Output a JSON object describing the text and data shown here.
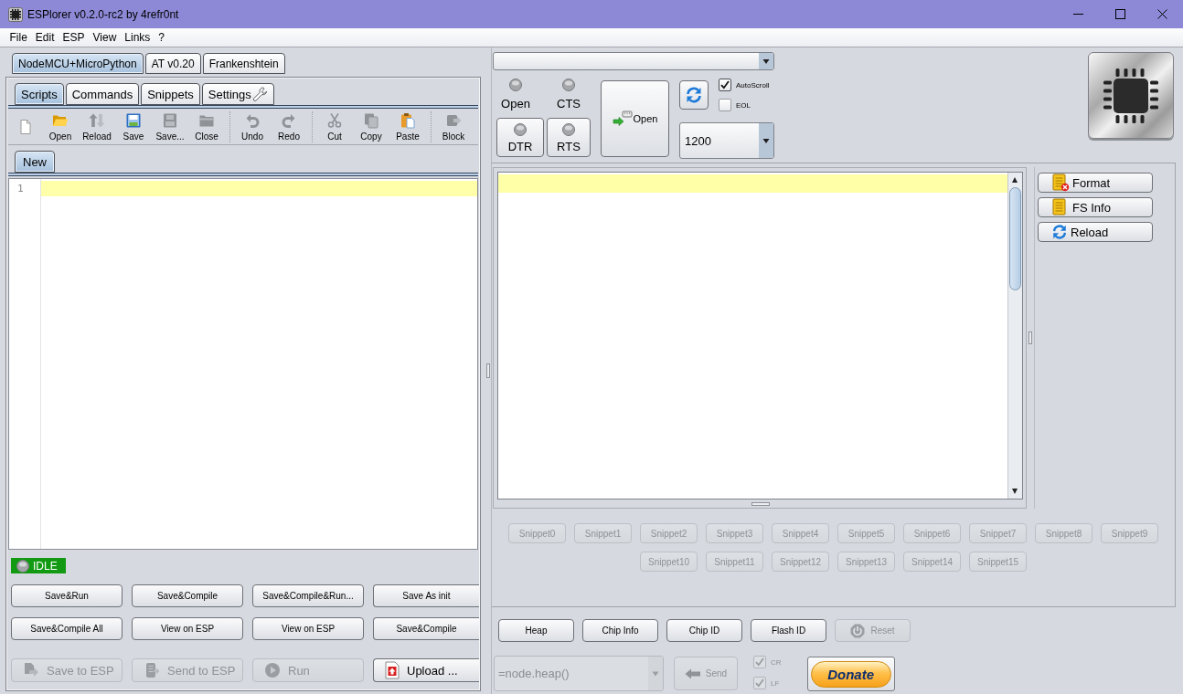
{
  "window": {
    "title": "ESPlorer v0.2.0-rc2 by 4refr0nt"
  },
  "menu": [
    "File",
    "Edit",
    "ESP",
    "View",
    "Links",
    "?"
  ],
  "firmware_tabs": [
    {
      "label": "NodeMCU+MicroPython",
      "selected": true
    },
    {
      "label": "AT v0.20",
      "selected": false
    },
    {
      "label": "Frankenshtein",
      "selected": false
    }
  ],
  "scripts_panel": {
    "tabs": [
      {
        "label": "Scripts",
        "selected": true,
        "kind": "plain"
      },
      {
        "label": "Commands",
        "selected": false,
        "kind": "plain"
      },
      {
        "label": "Snippets",
        "selected": false,
        "kind": "plain"
      },
      {
        "label": "Settings",
        "selected": false,
        "kind": "settings"
      }
    ],
    "toolbar_groups": [
      {
        "items": [
          {
            "kind": "new",
            "disabled": false
          },
          {
            "label": "Open",
            "kind": "open",
            "disabled": false
          },
          {
            "label": "Reload",
            "kind": "reload",
            "disabled": true
          },
          {
            "label": "Save",
            "kind": "save",
            "disabled": false
          },
          {
            "label": "Save...",
            "kind": "save-as",
            "disabled": true
          },
          {
            "label": "Close",
            "kind": "close",
            "disabled": true
          }
        ]
      },
      {
        "items": [
          {
            "label": "Undo",
            "kind": "undo",
            "disabled": true
          },
          {
            "label": "Redo",
            "kind": "redo",
            "disabled": true
          }
        ]
      },
      {
        "items": [
          {
            "label": "Cut",
            "kind": "cut",
            "disabled": true
          },
          {
            "label": "Copy",
            "kind": "copy",
            "disabled": true
          },
          {
            "label": "Paste",
            "kind": "paste",
            "disabled": false
          }
        ]
      },
      {
        "items": [
          {
            "label": "Block",
            "kind": "block",
            "disabled": true
          }
        ]
      }
    ],
    "file_tabs": [
      {
        "label": "New",
        "selected": true
      }
    ],
    "editor": {
      "line_numbers": [
        "1"
      ]
    },
    "status": {
      "label": "IDLE"
    },
    "actions": [
      "Save&Run",
      "Save&Compile",
      "Save&Compile&Run...",
      "Save As init",
      "Save&Compile All",
      "View on ESP",
      "View on ESP",
      "Save&Compile"
    ],
    "transfer_buttons": [
      {
        "label": "Save to ESP",
        "kind": "save",
        "disabled": true
      },
      {
        "label": "Send to ESP",
        "kind": "send",
        "disabled": true
      },
      {
        "label": "Run",
        "kind": "run",
        "disabled": true
      },
      {
        "label": "Upload ...",
        "kind": "upload",
        "disabled": false
      }
    ]
  },
  "connection": {
    "signals": [
      {
        "label": "Open",
        "kind": "indicator",
        "on": false
      },
      {
        "label": "CTS",
        "kind": "indicator",
        "on": false
      },
      {
        "label": "DTR",
        "kind": "toggle",
        "on": false
      },
      {
        "label": "RTS",
        "kind": "toggle",
        "on": false
      }
    ],
    "open_button": {
      "label": "Open"
    },
    "options": [
      {
        "label": "AutoScroll",
        "checked": true
      },
      {
        "label": "EOL",
        "checked": false
      }
    ],
    "baud_rate": {
      "value": "1200"
    }
  },
  "file_system_buttons": [
    {
      "label": "Format",
      "kind": "format"
    },
    {
      "label": "FS Info",
      "kind": "info"
    },
    {
      "label": "Reload",
      "kind": "reload"
    }
  ],
  "snippets": [
    {
      "label": "Snippet0",
      "disabled": true
    },
    {
      "label": "Snippet1",
      "disabled": true
    },
    {
      "label": "Snippet2",
      "disabled": true
    },
    {
      "label": "Snippet3",
      "disabled": true
    },
    {
      "label": "Snippet4",
      "disabled": true
    },
    {
      "label": "Snippet5",
      "disabled": true
    },
    {
      "label": "Snippet6",
      "disabled": true
    },
    {
      "label": "Snippet7",
      "disabled": true
    },
    {
      "label": "Snippet8",
      "disabled": true
    },
    {
      "label": "Snippet9",
      "disabled": true
    },
    {
      "label": "Snippet10",
      "disabled": true
    },
    {
      "label": "Snippet11",
      "disabled": true
    },
    {
      "label": "Snippet12",
      "disabled": true
    },
    {
      "label": "Snippet13",
      "disabled": true
    },
    {
      "label": "Snippet14",
      "disabled": true
    },
    {
      "label": "Snippet15",
      "disabled": true
    }
  ],
  "esp_commands": [
    {
      "label": "Heap",
      "kind": "text",
      "disabled": false
    },
    {
      "label": "Chip Info",
      "kind": "text",
      "disabled": false
    },
    {
      "label": "Chip ID",
      "kind": "text",
      "disabled": false
    },
    {
      "label": "Flash ID",
      "kind": "text",
      "disabled": false
    },
    {
      "label": "Reset",
      "kind": "reset",
      "disabled": true
    }
  ],
  "command_input": {
    "value": "=node.heap()",
    "disabled": true
  },
  "send_button": {
    "label": "Send",
    "disabled": true
  },
  "line_endings": [
    {
      "label": "CR",
      "checked": true,
      "disabled": true
    },
    {
      "label": "LF",
      "checked": true,
      "disabled": true
    }
  ],
  "donate_button": {
    "label": "Donate"
  }
}
